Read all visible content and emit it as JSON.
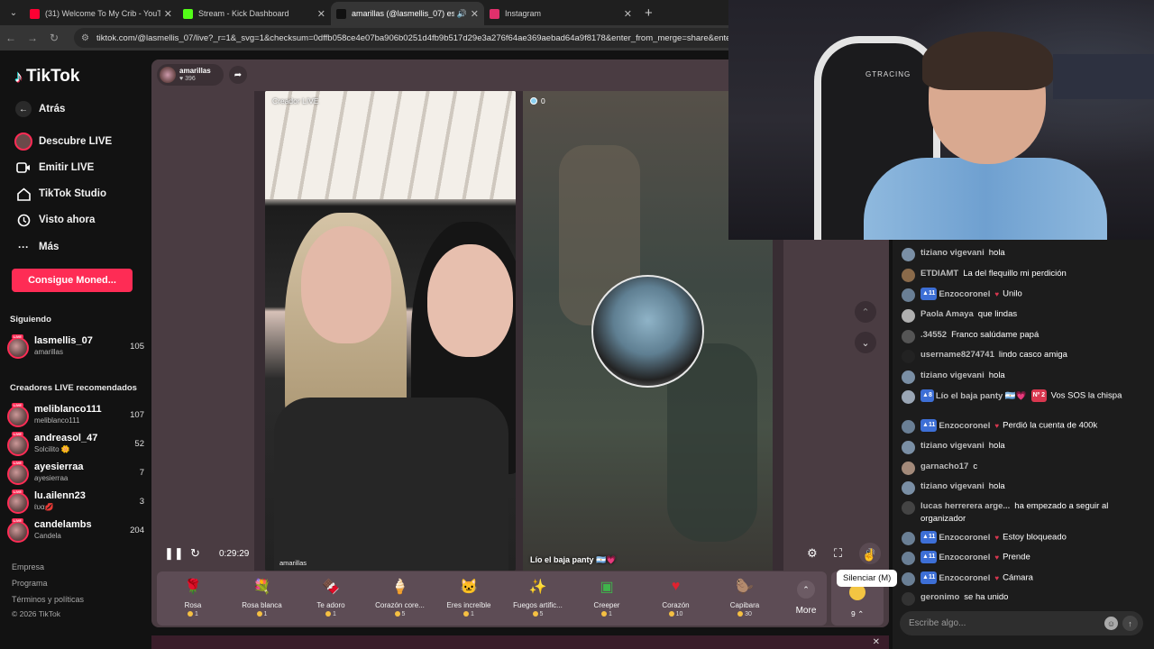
{
  "browser": {
    "tabs": [
      {
        "label": "(31) Welcome To My Crib - YouTube",
        "icon_color": "#ff0033",
        "active": false
      },
      {
        "label": "Stream - Kick Dashboard",
        "icon_color": "#53fc18",
        "active": false
      },
      {
        "label": "amarillas (@lasmellis_07) es...",
        "icon_color": "#111111",
        "active": true
      },
      {
        "label": "Instagram",
        "icon_color": "#e1306c",
        "active": false
      }
    ],
    "url": "tiktok.com/@lasmellis_07/live?_r=1&_svg=1&checksum=0dffb058ce4e07ba906b0251d4fb9b517d29e3a276f64ae369aebad64a9f8178&enter_from_merge=share&enter_me"
  },
  "sidebar": {
    "brand": "TikTok",
    "back": "Atrás",
    "nav": [
      {
        "label": "Descubre LIVE",
        "icon": "live-avatar-icon"
      },
      {
        "label": "Emitir LIVE",
        "icon": "camera-icon"
      },
      {
        "label": "TikTok Studio",
        "icon": "home-icon"
      },
      {
        "label": "Visto ahora",
        "icon": "history-icon"
      },
      {
        "label": "Más",
        "icon": "more-icon"
      }
    ],
    "coins_button": "Consigue Moned...",
    "following_title": "Siguiendo",
    "following": [
      {
        "name": "lasmellis_07",
        "sub": "amarillas",
        "count": "105"
      }
    ],
    "recommended_title": "Creadores LIVE recomendados",
    "recommended": [
      {
        "name": "meliblanco111",
        "sub": "meliblanco111",
        "count": "107"
      },
      {
        "name": "andreasol_47",
        "sub": "Solcilito 🌼",
        "count": "52"
      },
      {
        "name": "ayesierraa",
        "sub": "ayesierraa",
        "count": "7"
      },
      {
        "name": "lu.ailenn23",
        "sub": "ℓυα💋",
        "count": "3"
      },
      {
        "name": "candelambs",
        "sub": "Candela",
        "count": "204"
      }
    ],
    "footer": [
      "Empresa",
      "Programa",
      "Términos y políticas",
      "© 2026 TikTok"
    ]
  },
  "live": {
    "host_name": "amarillas",
    "host_likes": "396",
    "left_label": "Creador LIVE",
    "left_user": "amarillas",
    "right_count": "0",
    "guest_name": "Lío el baja panty 🇦🇷💗",
    "time": "0:29:29",
    "mute_tooltip": "Silenciar (M)"
  },
  "gifts": [
    {
      "name": "Rosa",
      "price": "1",
      "icon": "🌹",
      "color": "#c9253c"
    },
    {
      "name": "Rosa blanca",
      "price": "1",
      "icon": "💐",
      "color": "#e9e9e2"
    },
    {
      "name": "Te adoro",
      "price": "1",
      "icon": "🍫",
      "color": "#e23f4f"
    },
    {
      "name": "Corazón core...",
      "price": "5",
      "icon": "🍦",
      "color": "#f0a3a3"
    },
    {
      "name": "Eres increíble",
      "price": "1",
      "icon": "🐱",
      "color": "#caa37a"
    },
    {
      "name": "Fuegos artific...",
      "price": "5",
      "icon": "✨",
      "color": "#8a48e0"
    },
    {
      "name": "Creeper",
      "price": "1",
      "icon": "▣",
      "color": "#3fb54b"
    },
    {
      "name": "Corazón",
      "price": "10",
      "icon": "♥",
      "color": "#e0222f"
    },
    {
      "name": "Capibara",
      "price": "30",
      "icon": "🦫",
      "color": "#a06a3c"
    }
  ],
  "gifts_more": "More",
  "gift_count": "9",
  "chat": {
    "messages": [
      {
        "user": "tiziano vigevani",
        "text": "hola",
        "badges": [],
        "heart": false
      },
      {
        "user": "ETDIAMT",
        "text": "La del flequillo mi perdición",
        "badges": [],
        "heart": false
      },
      {
        "user": "Enzocoronel",
        "text": "Unilo",
        "badges": [
          "11"
        ],
        "heart": true
      },
      {
        "user": "Paola Amaya",
        "text": "que lindas",
        "badges": [],
        "heart": false
      },
      {
        "user": ".34552",
        "text": "Franco salúdame papá",
        "badges": [],
        "heart": false
      },
      {
        "user": "username8274741",
        "text": "lindo casco amiga",
        "badges": [],
        "heart": false
      },
      {
        "user": "tiziano vigevani",
        "text": "hola",
        "badges": [],
        "heart": false
      },
      {
        "user": "Lío el baja panty 🇦🇷💗",
        "text": "Vos SOS la chispa",
        "badges": [
          "8"
        ],
        "red_badge": "Nº 2",
        "heart": false
      },
      {
        "user": "Enzocoronel",
        "text": "Perdió la cuenta de 400k",
        "badges": [
          "11"
        ],
        "heart": true
      },
      {
        "user": "tiziano vigevani",
        "text": "hola",
        "badges": [],
        "heart": false
      },
      {
        "user": "garnacho17",
        "text": "c",
        "badges": [],
        "heart": false
      },
      {
        "user": "tiziano vigevani",
        "text": "hola",
        "badges": [],
        "heart": false
      },
      {
        "user": "lucas herrerera arge...",
        "text": "ha empezado a seguir al organizador",
        "badges": [],
        "heart": false
      },
      {
        "user": "Enzocoronel",
        "text": "Estoy bloqueado",
        "badges": [
          "11"
        ],
        "heart": true
      },
      {
        "user": "Enzocoronel",
        "text": "Prende",
        "badges": [
          "11"
        ],
        "heart": true
      },
      {
        "user": "Enzocoronel",
        "text": "Cámara",
        "badges": [
          "11"
        ],
        "heart": true
      },
      {
        "user": "geronimo",
        "text": "se ha unido",
        "badges": [],
        "heart": false
      }
    ],
    "input_placeholder": "Escribe algo..."
  },
  "webcam": {
    "chair_text": "GTRACING"
  }
}
